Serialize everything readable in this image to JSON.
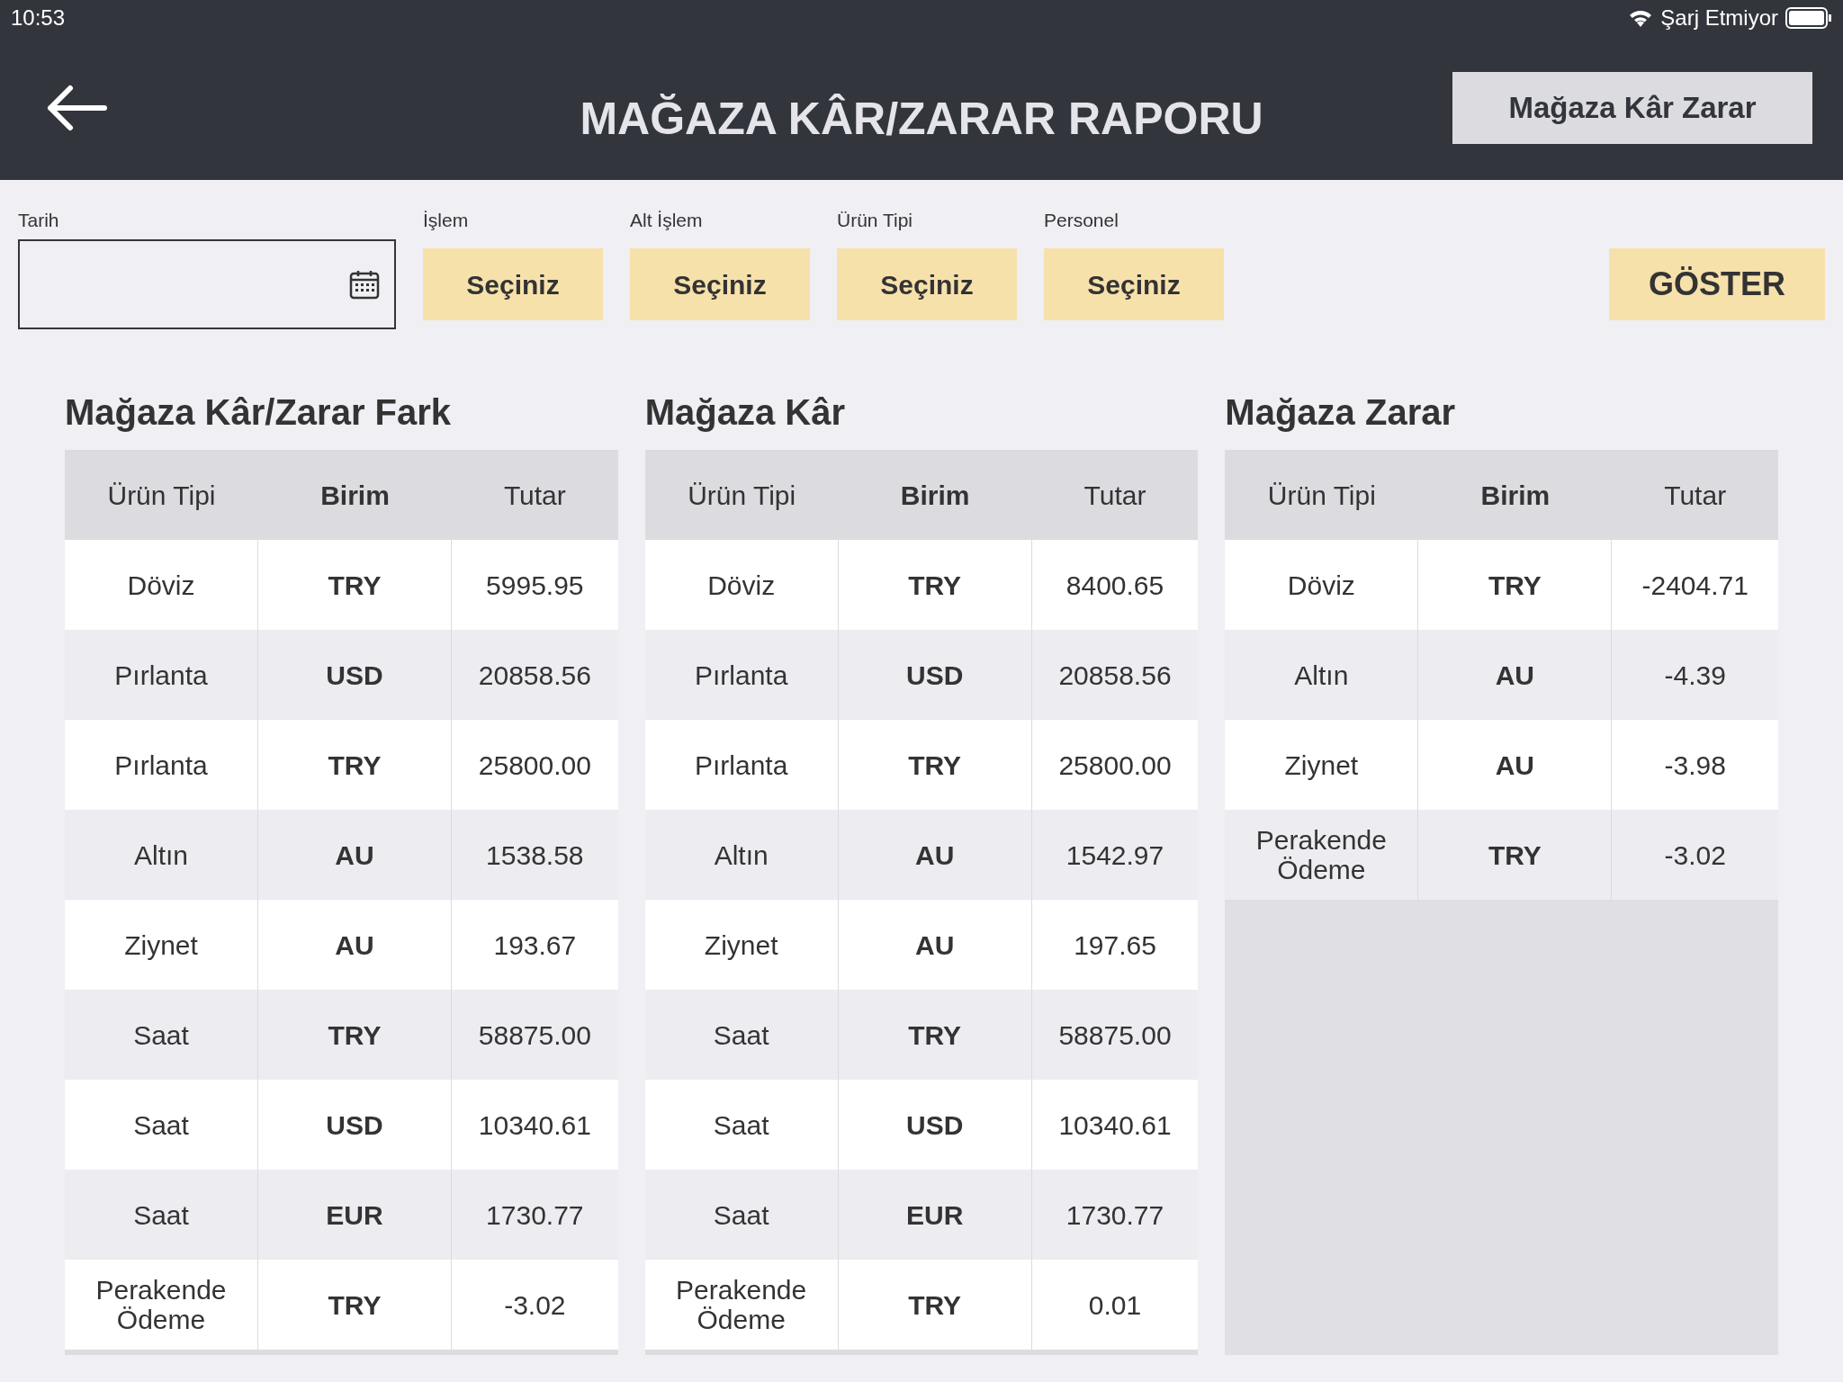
{
  "status_bar": {
    "time": "10:53",
    "battery_text": "Şarj Etmiyor"
  },
  "header": {
    "title": "MAĞAZA KÂR/ZARAR RAPORU",
    "action_button": "Mağaza Kâr Zarar"
  },
  "filters": [
    {
      "kind": "date",
      "label": "Tarih"
    },
    {
      "kind": "select",
      "label": "İşlem",
      "value": "Seçiniz"
    },
    {
      "kind": "select",
      "label": "Alt İşlem",
      "value": "Seçiniz"
    },
    {
      "kind": "select",
      "label": "Ürün Tipi",
      "value": "Seçiniz"
    },
    {
      "kind": "select",
      "label": "Personel",
      "value": "Seçiniz"
    }
  ],
  "show_button": "GÖSTER",
  "tables": [
    {
      "title": "Mağaza Kâr/Zarar Fark",
      "columns": [
        "Ürün Tipi",
        "Birim",
        "Tutar"
      ],
      "rows": [
        [
          "Döviz",
          "TRY",
          "5995.95"
        ],
        [
          "Pırlanta",
          "USD",
          "20858.56"
        ],
        [
          "Pırlanta",
          "TRY",
          "25800.00"
        ],
        [
          "Altın",
          "AU",
          "1538.58"
        ],
        [
          "Ziynet",
          "AU",
          "193.67"
        ],
        [
          "Saat",
          "TRY",
          "58875.00"
        ],
        [
          "Saat",
          "USD",
          "10340.61"
        ],
        [
          "Saat",
          "EUR",
          "1730.77"
        ],
        [
          "Perakende Ödeme",
          "TRY",
          "-3.02"
        ]
      ]
    },
    {
      "title": "Mağaza Kâr",
      "columns": [
        "Ürün Tipi",
        "Birim",
        "Tutar"
      ],
      "rows": [
        [
          "Döviz",
          "TRY",
          "8400.65"
        ],
        [
          "Pırlanta",
          "USD",
          "20858.56"
        ],
        [
          "Pırlanta",
          "TRY",
          "25800.00"
        ],
        [
          "Altın",
          "AU",
          "1542.97"
        ],
        [
          "Ziynet",
          "AU",
          "197.65"
        ],
        [
          "Saat",
          "TRY",
          "58875.00"
        ],
        [
          "Saat",
          "USD",
          "10340.61"
        ],
        [
          "Saat",
          "EUR",
          "1730.77"
        ],
        [
          "Perakende Ödeme",
          "TRY",
          "0.01"
        ]
      ]
    },
    {
      "title": "Mağaza Zarar",
      "columns": [
        "Ürün Tipi",
        "Birim",
        "Tutar"
      ],
      "rows": [
        [
          "Döviz",
          "TRY",
          "-2404.71"
        ],
        [
          "Altın",
          "AU",
          "-4.39"
        ],
        [
          "Ziynet",
          "AU",
          "-3.98"
        ],
        [
          "Perakende Ödeme",
          "TRY",
          "-3.02"
        ]
      ]
    }
  ]
}
